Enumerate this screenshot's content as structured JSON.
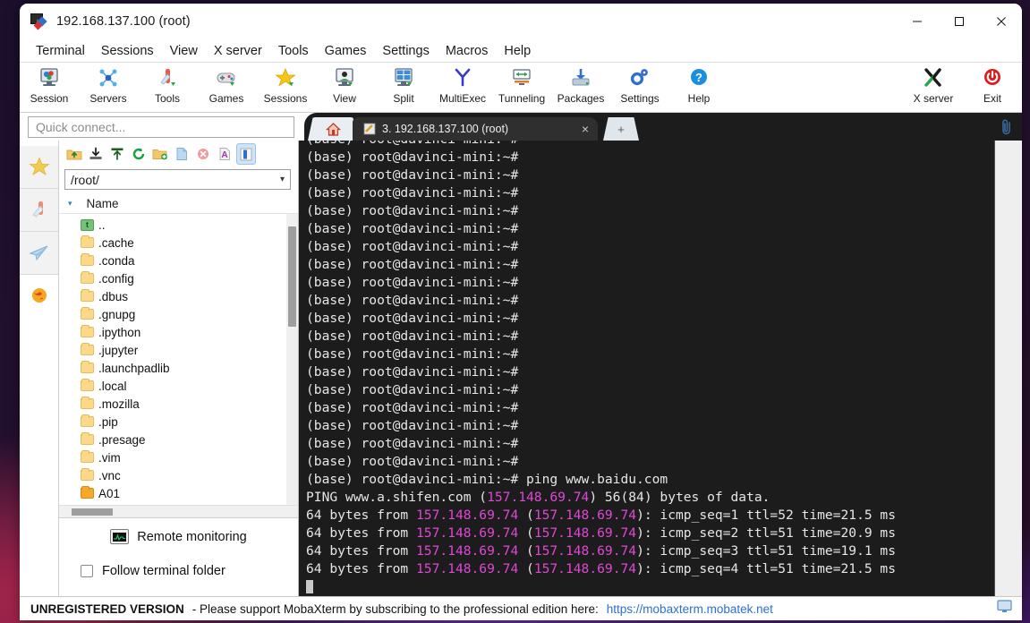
{
  "window": {
    "title": "192.168.137.100 (root)",
    "icon": "mobaxterm-icon",
    "controls": {
      "minimize": "minimize-button",
      "maximize": "maximize-button",
      "close": "close-button"
    }
  },
  "menubar": {
    "items": [
      "Terminal",
      "Sessions",
      "View",
      "X server",
      "Tools",
      "Games",
      "Settings",
      "Macros",
      "Help"
    ]
  },
  "toolbar": {
    "left": [
      {
        "label": "Session",
        "icon": "session-icon"
      },
      {
        "label": "Servers",
        "icon": "servers-icon"
      },
      {
        "label": "Tools",
        "icon": "tools-icon"
      },
      {
        "label": "Games",
        "icon": "games-icon"
      },
      {
        "label": "Sessions",
        "icon": "sessions-star-icon"
      },
      {
        "label": "View",
        "icon": "view-icon"
      },
      {
        "label": "Split",
        "icon": "split-icon"
      },
      {
        "label": "MultiExec",
        "icon": "multiexec-icon"
      },
      {
        "label": "Tunneling",
        "icon": "tunneling-icon"
      },
      {
        "label": "Packages",
        "icon": "packages-icon"
      },
      {
        "label": "Settings",
        "icon": "settings-gear-icon"
      },
      {
        "label": "Help",
        "icon": "help-icon"
      }
    ],
    "right": [
      {
        "label": "X server",
        "icon": "x-server-icon"
      },
      {
        "label": "Exit",
        "icon": "exit-power-icon"
      }
    ]
  },
  "quick_connect": {
    "placeholder": "Quick connect...",
    "value": ""
  },
  "tabs": {
    "home_label": "",
    "session": {
      "label": "3. 192.168.137.100 (root)",
      "close": "×"
    },
    "new_tab": "+",
    "clip": "📎"
  },
  "rail": {
    "items": [
      {
        "name": "sidebar-favorites",
        "icon": "star-icon"
      },
      {
        "name": "sidebar-tools",
        "icon": "swiss-knife-icon"
      },
      {
        "name": "sidebar-sftp",
        "icon": "paper-plane-icon"
      },
      {
        "name": "sidebar-macros",
        "icon": "globe-icon"
      }
    ]
  },
  "file_browser": {
    "toolbar_icons": [
      "parent-folder-icon",
      "download-icon",
      "upload-icon",
      "refresh-icon",
      "new-folder-icon",
      "new-file-icon",
      "delete-icon",
      "rename-icon",
      "toggle-view-icon"
    ],
    "path": "/root/",
    "path_caret": "▾",
    "column_header": "Name",
    "sort_caret": "▾",
    "entries": [
      {
        "name": "..",
        "type": "up"
      },
      {
        "name": ".cache",
        "type": "folder"
      },
      {
        "name": ".conda",
        "type": "folder"
      },
      {
        "name": ".config",
        "type": "folder"
      },
      {
        "name": ".dbus",
        "type": "folder"
      },
      {
        "name": ".gnupg",
        "type": "folder"
      },
      {
        "name": ".ipython",
        "type": "folder"
      },
      {
        "name": ".jupyter",
        "type": "folder"
      },
      {
        "name": ".launchpadlib",
        "type": "folder"
      },
      {
        "name": ".local",
        "type": "folder"
      },
      {
        "name": ".mozilla",
        "type": "folder"
      },
      {
        "name": ".pip",
        "type": "folder"
      },
      {
        "name": ".presage",
        "type": "folder"
      },
      {
        "name": ".vim",
        "type": "folder"
      },
      {
        "name": ".vnc",
        "type": "folder"
      },
      {
        "name": "A01",
        "type": "folder-dark"
      }
    ],
    "remote_monitoring": {
      "label": "Remote monitoring",
      "icon": "monitor-graph-icon"
    },
    "follow_terminal_folder": {
      "label": "Follow terminal folder",
      "checked": false
    }
  },
  "terminal": {
    "prompt": "(base) root@davinci-mini:~#",
    "prompt_line_count": 19,
    "command_line": {
      "prompt": "(base) root@davinci-mini:~#",
      "command": " ping www.baidu.com"
    },
    "ping_header": {
      "pre": "PING www.a.shifen.com (",
      "ip": "157.148.69.74",
      "post": ") 56(84) bytes of data."
    },
    "ip": "157.148.69.74",
    "replies": [
      {
        "pre": "64 bytes from ",
        "tail": "icmp_seq=1 ttl=52 time=21.5 ms"
      },
      {
        "pre": "64 bytes from ",
        "tail": "icmp_seq=2 ttl=51 time=20.9 ms"
      },
      {
        "pre": "64 bytes from ",
        "tail": "icmp_seq=3 ttl=51 time=19.1 ms"
      },
      {
        "pre": "64 bytes from ",
        "tail": "icmp_seq=4 ttl=51 time=21.5 ms"
      }
    ],
    "colors": {
      "foreground": "#e6e6e6",
      "background": "#1c1c1c",
      "ip_color": "#e246d6"
    }
  },
  "statusbar": {
    "unregistered": "UNREGISTERED VERSION",
    "message": "-  Please support MobaXterm by subscribing to the professional edition here:",
    "link": "https://mobaxterm.mobatek.net",
    "icon": "display-icon"
  }
}
